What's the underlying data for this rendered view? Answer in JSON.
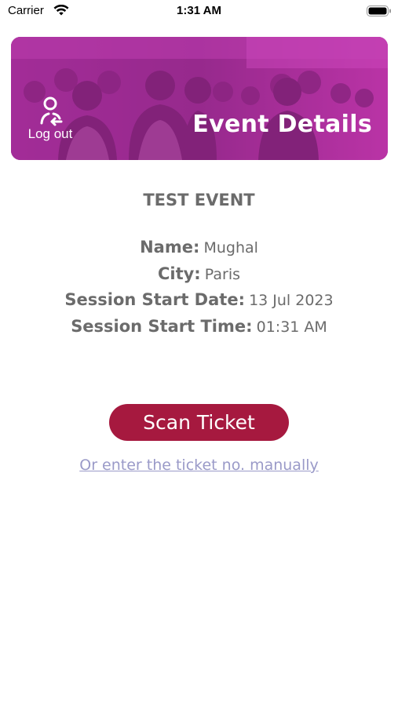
{
  "status_bar": {
    "carrier": "Carrier",
    "time": "1:31 AM",
    "wifi_icon": "wifi-icon",
    "battery_icon": "battery-icon"
  },
  "header": {
    "logout_label": "Log out",
    "logout_icon": "logout-user-icon",
    "title": "Event Details",
    "overlay_color": "#b0279e"
  },
  "event": {
    "title": "TEST EVENT",
    "name_label": "Name:",
    "name_value": "Mughal",
    "city_label": "City:",
    "city_value": "Paris",
    "start_date_label": "Session Start Date:",
    "start_date_value": "13 Jul 2023",
    "start_time_label": "Session Start Time:",
    "start_time_value": "01:31 AM"
  },
  "actions": {
    "scan_label": "Scan Ticket",
    "manual_link": "Or enter the ticket no. manually",
    "scan_color": "#a6193f",
    "link_color": "#9a9ac8"
  }
}
